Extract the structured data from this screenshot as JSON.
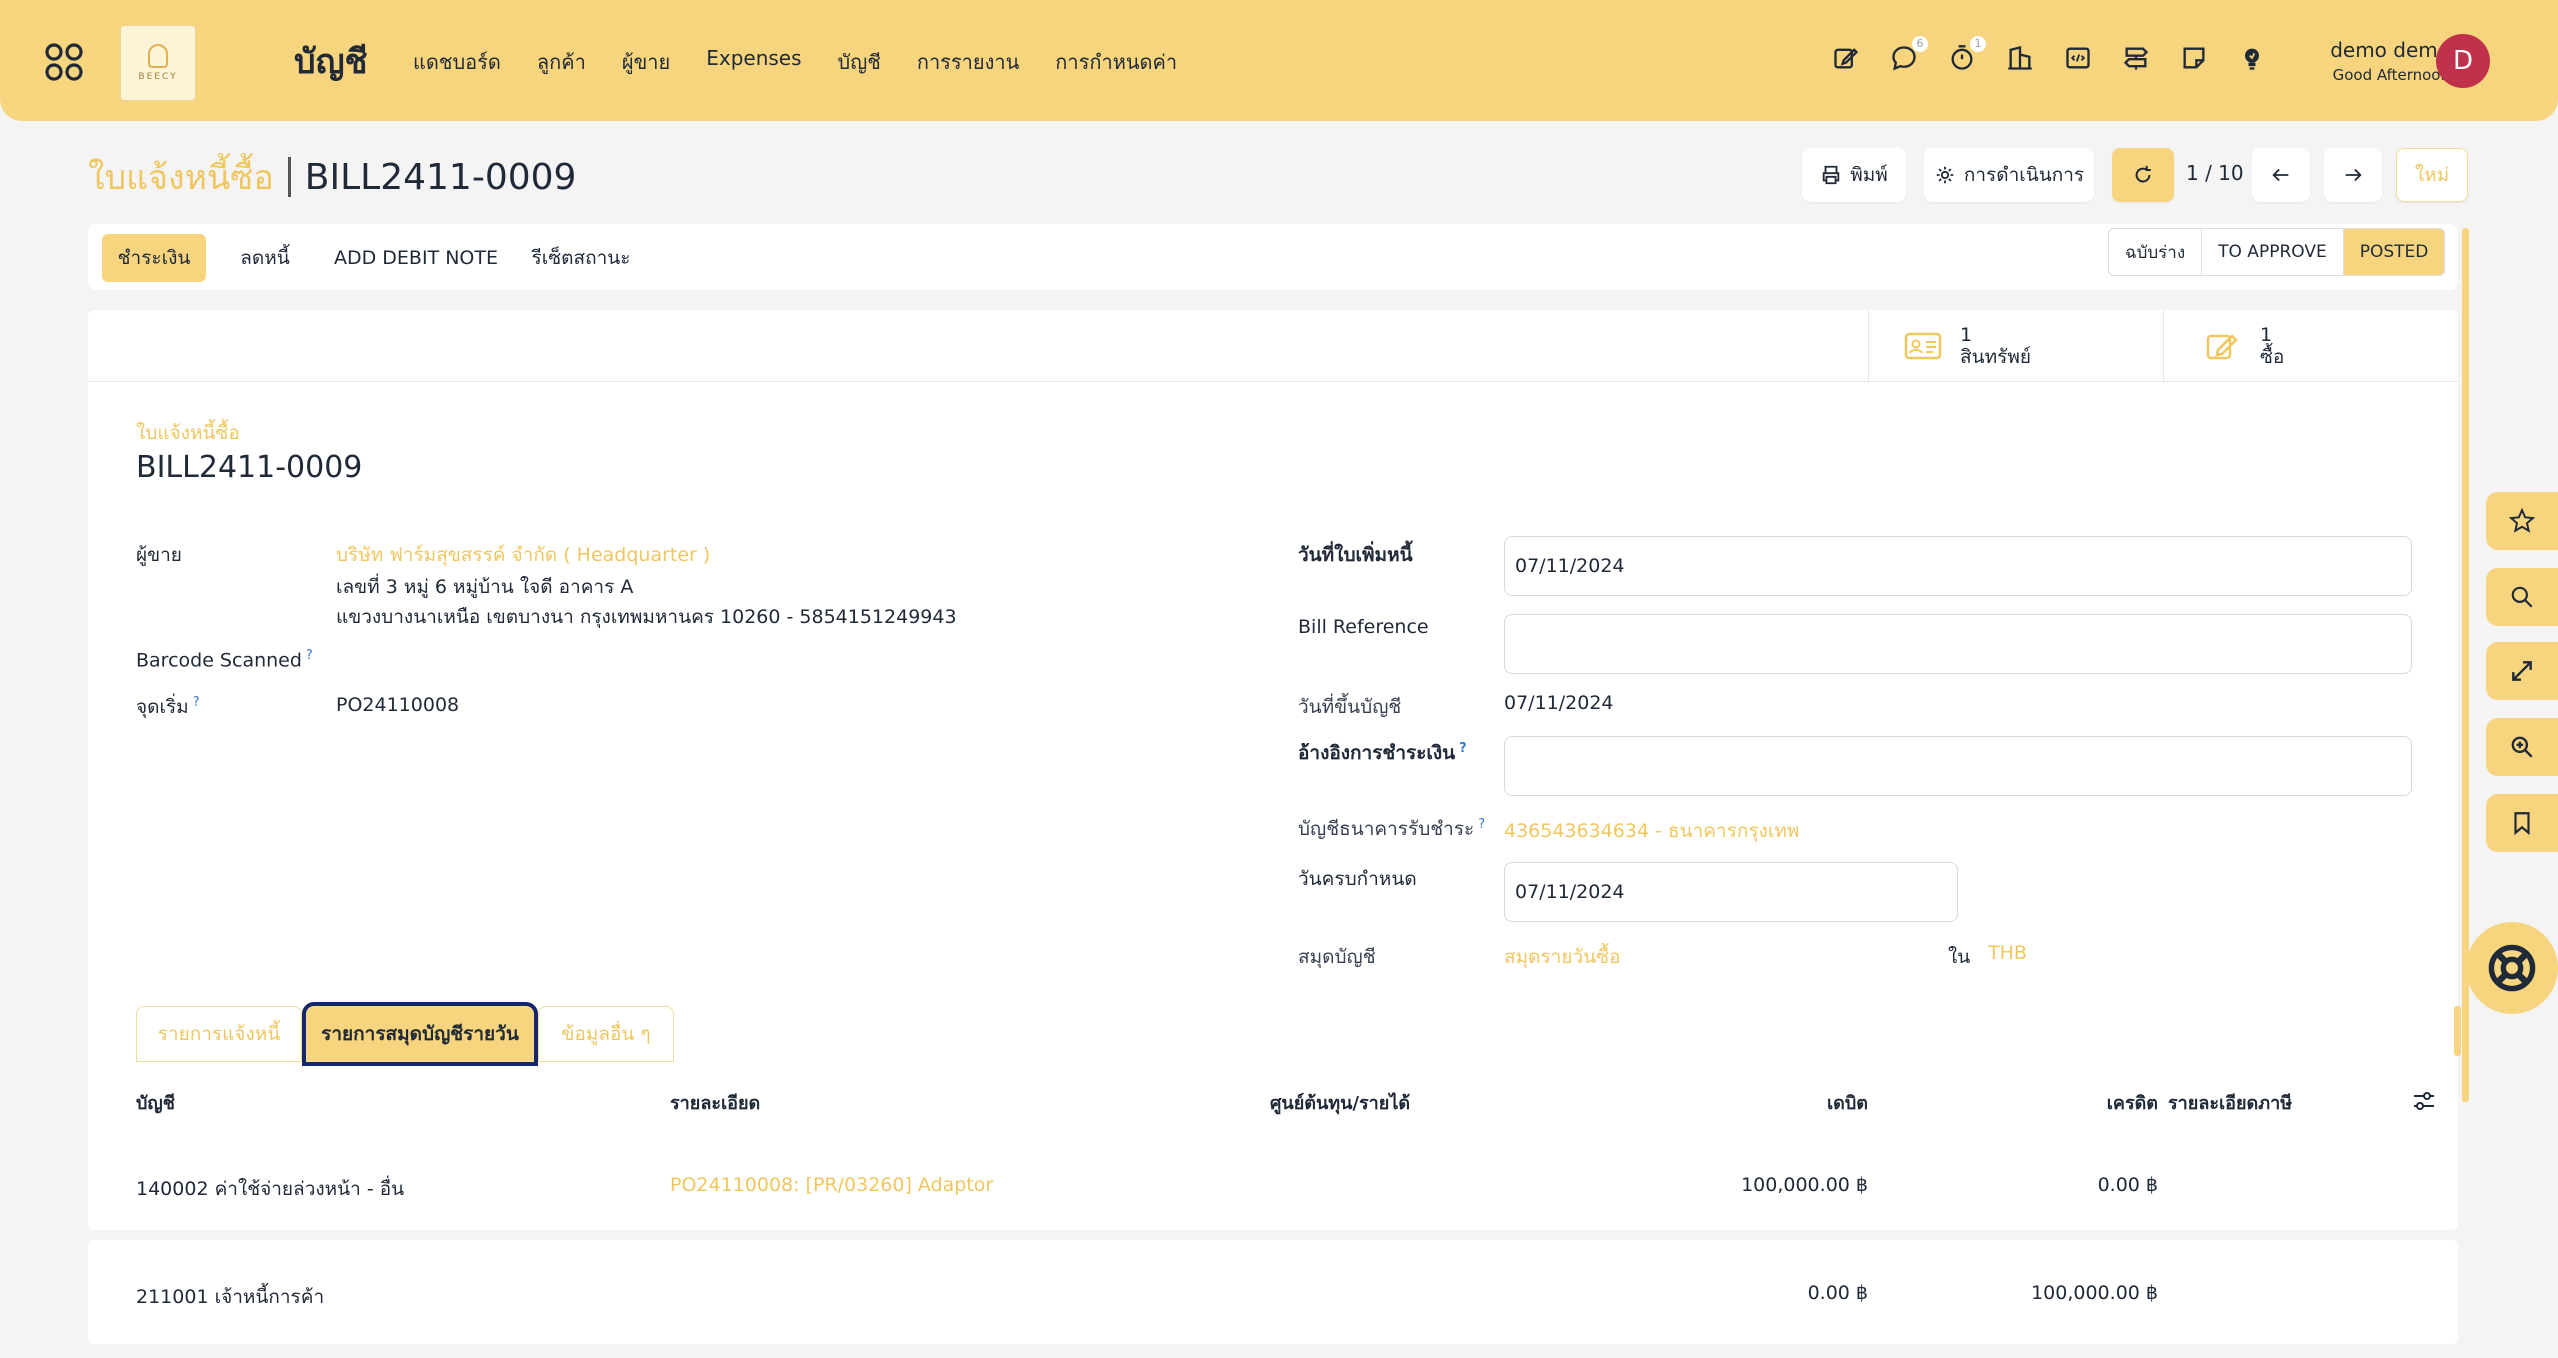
{
  "navbar": {
    "logo_text": "BEECY",
    "app_title": "บัญชี",
    "menu": [
      "แดชบอร์ด",
      "ลูกค้า",
      "ผู้ขาย",
      "Expenses",
      "บัญชี",
      "การรายงาน",
      "การกำหนดค่า"
    ],
    "messages_badge": "6",
    "activities_badge": "1",
    "user_name": "demo demo",
    "greeting": "Good Afternoon",
    "avatar_letter": "D"
  },
  "control": {
    "breadcrumb_parent": "ใบแจ้งหนี้ซื้อ",
    "breadcrumb_current": "BILL2411-0009",
    "print_label": "พิมพ์",
    "action_label": "การดำเนินการ",
    "pager": "1 / 10",
    "new_label": "ใหม่"
  },
  "statusbar": {
    "buttons": [
      "ชำระเงิน",
      "ลดหนี้",
      "ADD DEBIT NOTE",
      "รีเซ็ตสถานะ"
    ],
    "stages": [
      "ฉบับร่าง",
      "TO APPROVE",
      "POSTED"
    ],
    "active_stage": "POSTED"
  },
  "smart_buttons": [
    {
      "count": "1",
      "label": "สินทรัพย์"
    },
    {
      "count": "1",
      "label": "ซื้อ"
    }
  ],
  "form": {
    "doc_type_label": "ใบแจ้งหนี้ซื้อ",
    "doc_name": "BILL2411-0009",
    "vendor_label": "ผู้ขาย",
    "vendor_name": "บริษัท ฟาร์มสุขสรรค์ จำกัด ( Headquarter )",
    "vendor_address_1": "เลขที่ 3 หมู่ 6 หมู่บ้าน ใจดี อาคาร A",
    "vendor_address_2": "แขวงบางนาเหนือ เขตบางนา กรุงเทพมหานคร 10260 - 5854151249943",
    "barcode_label": "Barcode Scanned",
    "origin_label": "จุดเริ่ม",
    "origin_value": "PO24110008",
    "bill_date_label": "วันที่ใบเพิ่มหนี้",
    "bill_date_value": "07/11/2024",
    "bill_ref_label": "Bill Reference",
    "bill_ref_value": "",
    "acc_date_label": "วันที่ขึ้นบัญชี",
    "acc_date_value": "07/11/2024",
    "payment_ref_label": "อ้างอิงการชำระเงิน",
    "payment_ref_value": "",
    "bank_label": "บัญชีธนาคารรับชำระ",
    "bank_value": "436543634634 - ธนาคารกรุงเทพ",
    "due_date_label": "วันครบกำหนด",
    "due_date_value": "07/11/2024",
    "journal_label": "สมุดบัญชี",
    "journal_value": "สมุดรายวันซื้อ",
    "currency_in": "ใน",
    "currency_value": "THB"
  },
  "tabs": [
    "รายการแจ้งหนี้",
    "รายการสมุดบัญชีรายวัน",
    "ข้อมูลอื่น ๆ"
  ],
  "table": {
    "headers": [
      "บัญชี",
      "รายละเอียด",
      "ศูนย์ต้นทุน/รายได้",
      "เดบิต",
      "เครดิต",
      "รายละเอียดภาษี"
    ],
    "rows": [
      {
        "account": "140002 ค่าใช้จ่ายล่วงหน้า - อื่น",
        "label": "PO24110008: [PR/03260] Adaptor",
        "analytic": "",
        "debit": "100,000.00 ฿",
        "credit": "0.00 ฿"
      },
      {
        "account": "211001 เจ้าหนี้การค้า",
        "label": "",
        "analytic": "",
        "debit": "0.00 ฿",
        "credit": "100,000.00 ฿"
      }
    ]
  },
  "colors": {
    "brand": "#f7d57e",
    "link": "#f0c75e",
    "avatar": "#c0314c",
    "focus": "#14266b"
  },
  "icons": {
    "apps": "apps-grid-icon",
    "rail": [
      "star-icon",
      "search-icon",
      "expand-icon",
      "zoom-icon",
      "bookmark-icon"
    ],
    "help": "lifebuoy-icon"
  }
}
